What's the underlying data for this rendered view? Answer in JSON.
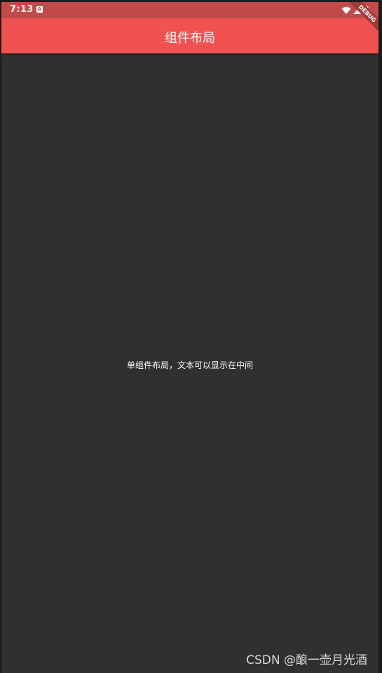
{
  "status_bar": {
    "time": "7:13",
    "notification_icon": "a-icon",
    "icons": [
      "wifi-icon",
      "signal-icon",
      "battery-icon"
    ],
    "color": "#c34a4a"
  },
  "app_bar": {
    "title": "组件布局",
    "color": "#f05252"
  },
  "debug_banner": {
    "label": "DEBUG"
  },
  "body": {
    "center_text": "单组件布局，文本可以显示在中间",
    "background": "#303030"
  },
  "watermark": {
    "text": "CSDN @酿一壶月光酒"
  }
}
